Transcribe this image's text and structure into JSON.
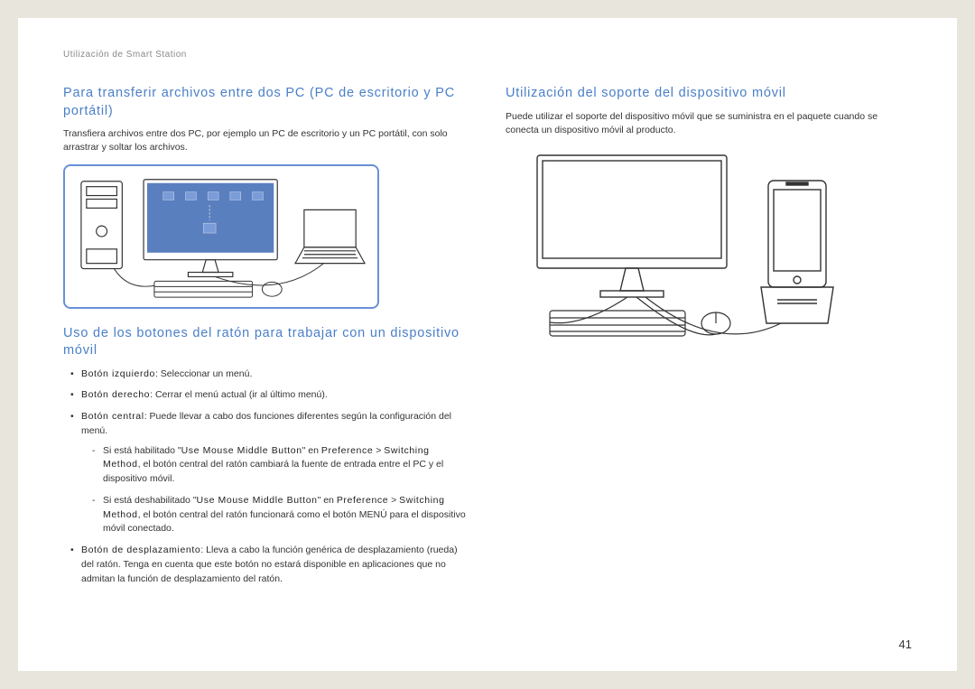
{
  "header": "Utilización de Smart Station",
  "pageNumber": "41",
  "left": {
    "h1": "Para transferir archivos entre dos PC (PC de escritorio y PC portátil)",
    "p1": "Transfiera archivos entre dos PC, por ejemplo un PC de escritorio y un PC portátil, con solo arrastrar y soltar los archivos.",
    "h2": "Uso de los botones del ratón para trabajar con un dispositivo móvil",
    "b1_term": "Botón izquierdo",
    "b1_text": ": Seleccionar un menú.",
    "b2_term": "Botón derecho",
    "b2_text": ": Cerrar el menú actual (ir al último menú).",
    "b3_term": "Botón central",
    "b3_text": ": Puede llevar a cabo dos funciones diferentes según la configuración del menú.",
    "b3a_pre": "Si está habilitado \"",
    "b3a_q": "Use Mouse Middle Button",
    "b3a_mid": "\" en ",
    "b3a_pref": "Preference",
    "b3a_gt": " > ",
    "b3a_sw": "Switching Method",
    "b3a_post": ", el botón central del ratón cambiará la fuente de entrada entre el PC y el dispositivo móvil.",
    "b3b_pre": "Si está deshabilitado \"",
    "b3b_q": "Use Mouse Middle Button",
    "b3b_mid": "\" en ",
    "b3b_pref": "Preference",
    "b3b_gt": " > ",
    "b3b_sw": "Switching Method",
    "b3b_post": ", el botón central del ratón funcionará como el botón MENÚ para el dispositivo móvil conectado.",
    "b4_term": "Botón de desplazamiento",
    "b4_text": ": Lleva a cabo la función genérica de desplazamiento (rueda) del ratón. Tenga en cuenta que este botón no estará disponible en aplicaciones que no admitan la función de desplazamiento del ratón."
  },
  "right": {
    "h1": "Utilización del soporte del dispositivo móvil",
    "p1": "Puede utilizar el soporte del dispositivo móvil que se suministra en el paquete cuando se conecta un dispositivo móvil al producto."
  }
}
